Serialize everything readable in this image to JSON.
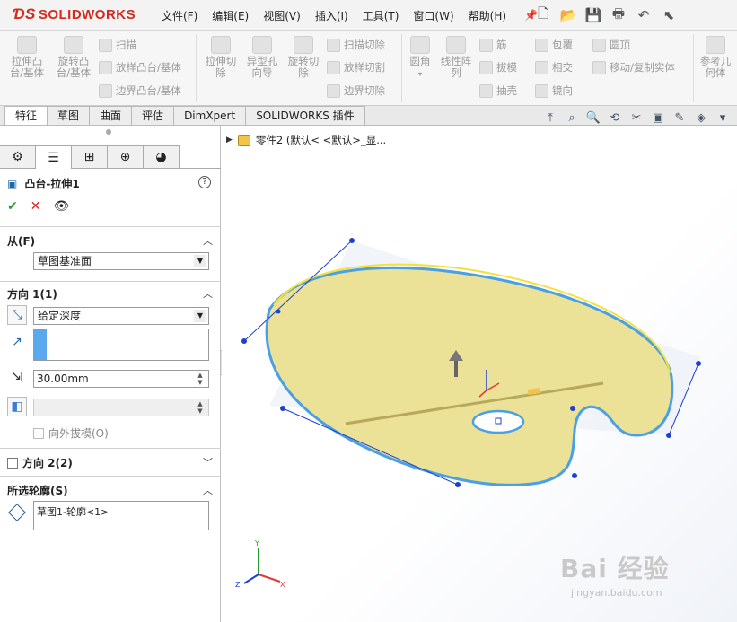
{
  "app": {
    "logo": "SOLIDWORKS"
  },
  "menubar": [
    "文件(F)",
    "编辑(E)",
    "视图(V)",
    "插入(I)",
    "工具(T)",
    "窗口(W)",
    "帮助(H)"
  ],
  "ribbon": {
    "extrude_boss": "拉伸凸台/基体",
    "revolve_boss": "旋转凸台/基体",
    "sweep": "扫描",
    "loft": "放样凸台/基体",
    "boundary": "边界凸台/基体",
    "extrude_cut": "拉伸切除",
    "hole_wizard": "异型孔向导",
    "revolve_cut": "旋转切除",
    "swept_cut": "扫描切除",
    "lofted_cut": "放样切割",
    "boundary_cut": "边界切除",
    "fillet": "圆角",
    "linear_pattern": "线性阵列",
    "rib": "筋",
    "draft": "拔模",
    "shell": "抽壳",
    "wrap": "包覆",
    "intersect": "相交",
    "mirror": "镜向",
    "dome": "圆顶",
    "move_copy": "移动/复制实体",
    "reference_geometry": "参考几何体"
  },
  "tabs": [
    "特征",
    "草图",
    "曲面",
    "评估",
    "DimXpert",
    "SOLIDWORKS 插件"
  ],
  "active_tab": 0,
  "property_manager": {
    "title": "凸台-拉伸1",
    "from": {
      "label": "从(F)",
      "value": "草图基准面"
    },
    "direction1": {
      "label": "方向 1(1)",
      "end_condition": "给定深度",
      "depth": "30.00mm",
      "draft_outward": "向外拔模(O)"
    },
    "direction2": {
      "label": "方向 2(2)"
    },
    "selected_contours": {
      "label": "所选轮廓(S)",
      "value": "草图1-轮廓<1>"
    }
  },
  "feature_tree": {
    "root": "零件2  (默认< <默认>_显..."
  },
  "triad": {
    "x": "X",
    "y": "Y",
    "z": "Z"
  },
  "watermark": {
    "brand": "Bai 经验",
    "url": "jingyan.baidu.com"
  },
  "colors": {
    "accent": "#d52b1e",
    "highlight_blue": "#5aa9ef",
    "annotation_red": "#e53935",
    "part_yellow": "#ece495"
  }
}
